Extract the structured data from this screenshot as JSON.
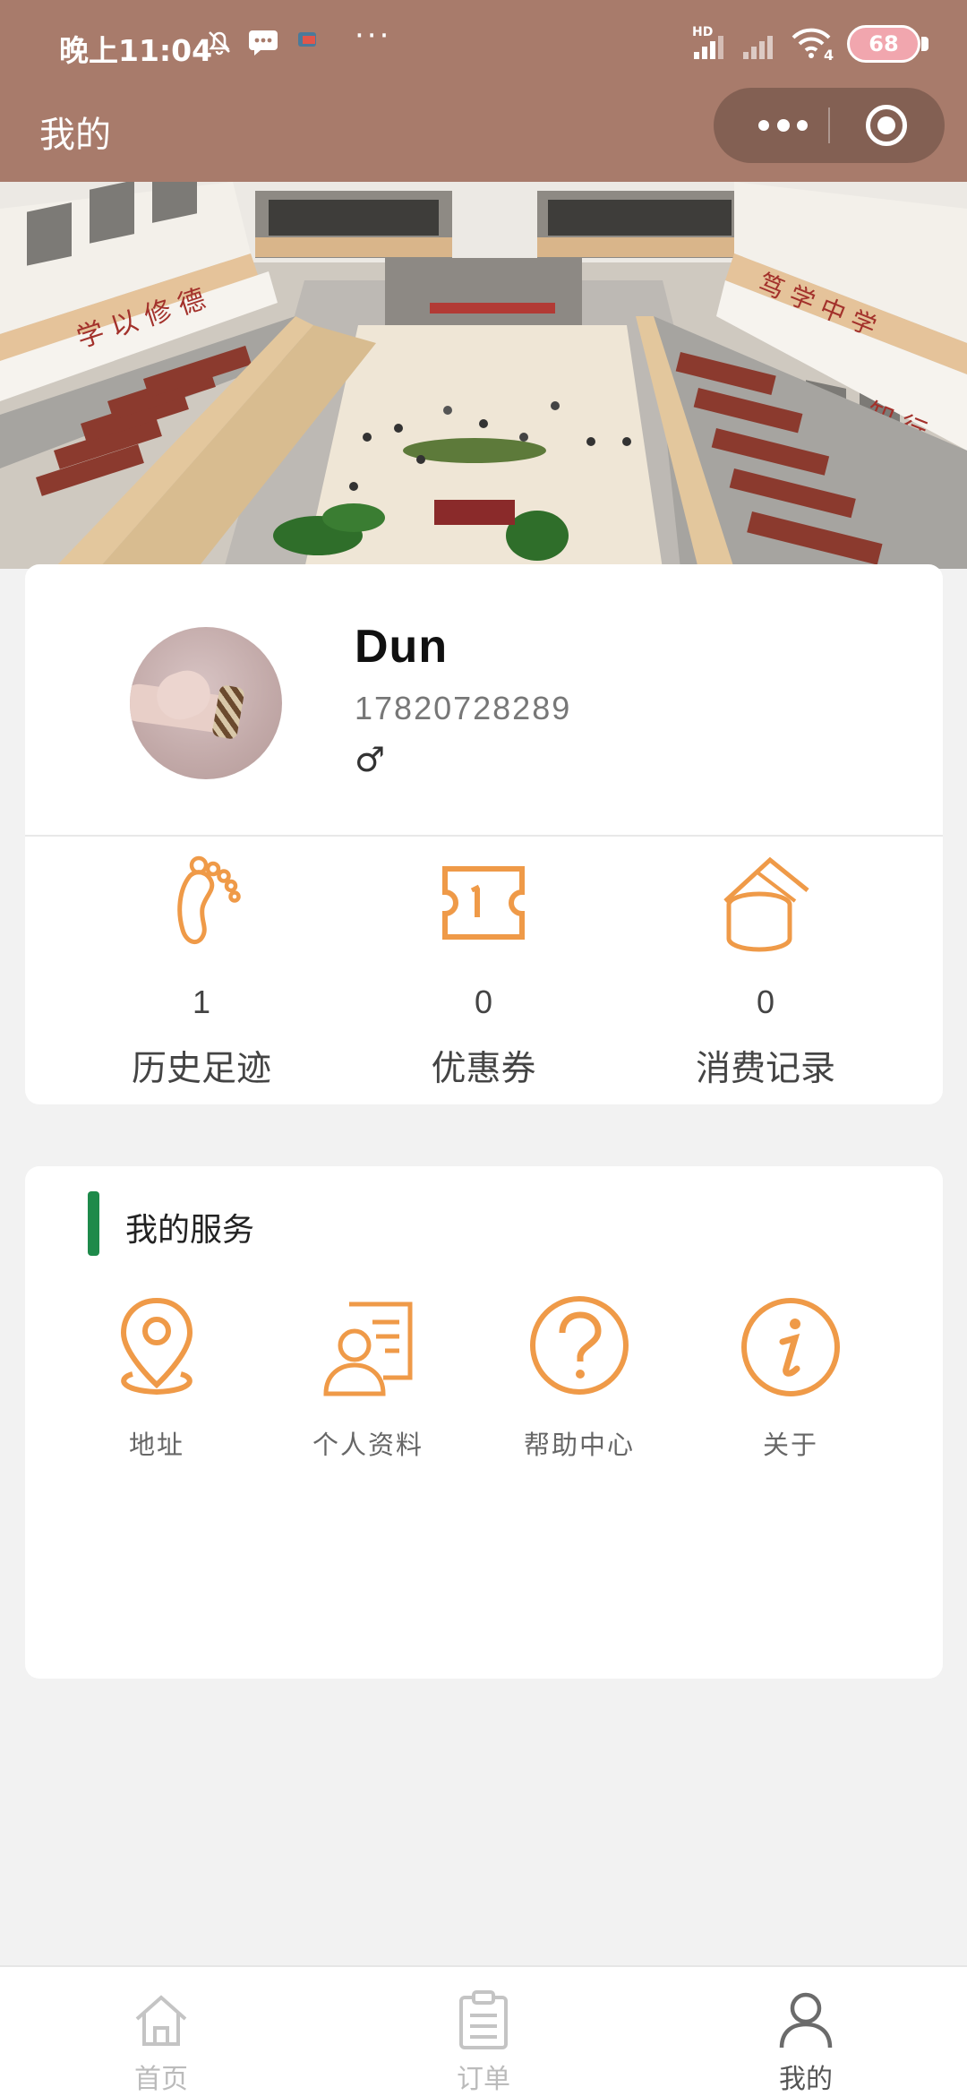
{
  "status_bar": {
    "time": "晚上11:04",
    "icons": [
      "mute-bell-icon",
      "message-icon",
      "app-icon",
      "more-dots-icon",
      "signal-icon",
      "wifi-icon"
    ],
    "network_label": "HD",
    "wifi_label": "4",
    "battery": "68"
  },
  "nav": {
    "title": "我的",
    "menu_icon": "more-dots-icon",
    "close_icon": "target-circle-icon"
  },
  "profile": {
    "name": "Dun",
    "phone": "17820728289",
    "gender_symbol": "♂"
  },
  "stats": [
    {
      "icon": "footprint-icon",
      "value": "1",
      "label": "历史足迹"
    },
    {
      "icon": "coupon-ticket-icon",
      "value": "0",
      "label": "优惠券"
    },
    {
      "icon": "coins-wallet-icon",
      "value": "0",
      "label": "消费记录"
    }
  ],
  "services": {
    "title": "我的服务",
    "items": [
      {
        "icon": "location-pin-icon",
        "label": "地址"
      },
      {
        "icon": "profile-document-icon",
        "label": "个人资料"
      },
      {
        "icon": "question-circle-icon",
        "label": "帮助中心"
      },
      {
        "icon": "info-circle-icon",
        "label": "关于"
      }
    ]
  },
  "tabbar": {
    "items": [
      {
        "icon": "home-icon",
        "label": "首页",
        "active": false
      },
      {
        "icon": "order-clipboard-icon",
        "label": "订单",
        "active": false
      },
      {
        "icon": "user-icon",
        "label": "我的",
        "active": true
      }
    ]
  },
  "colors": {
    "header_bg": "#a87b6b",
    "accent_orange": "#ef9a48",
    "service_bar_green": "#1e8a4a",
    "page_bg": "#f2f2f2"
  }
}
